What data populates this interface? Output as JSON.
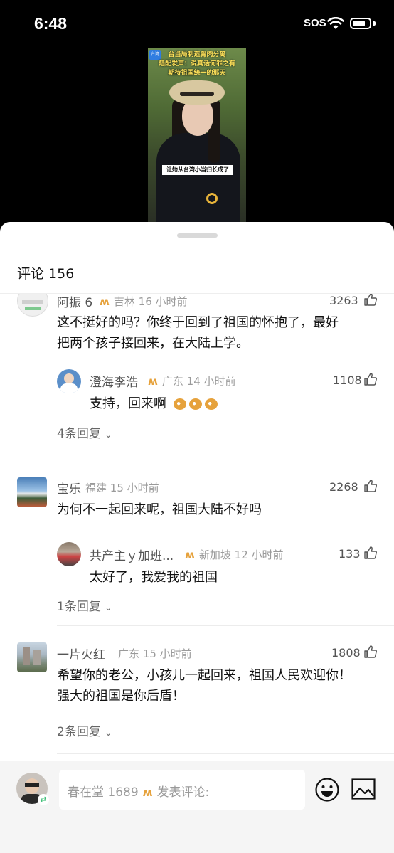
{
  "status_bar": {
    "time": "6:48",
    "sos": "SOS"
  },
  "video": {
    "caption_lines": [
      "台当局制造骨肉分离",
      "陆配发声：说真话何罪之有",
      "期待祖国统一的那天"
    ],
    "subtitle": "让她从台湾小当归长成了",
    "badge": "台湾"
  },
  "sheet": {
    "title": "评论 156"
  },
  "comments": [
    {
      "user": "阿振 6",
      "region": "吉林",
      "time": "16 小时前",
      "likes": "3263",
      "text_lines": [
        "这不挺好的吗？你终于回到了祖国的怀抱了，最好",
        "把两个孩子接回来，在大陆上学。"
      ],
      "reply": {
        "user": "澄海李浩",
        "region": "广东",
        "time": "14 小时前",
        "likes": "1108",
        "text": "支持，回来啊"
      },
      "more": "4条回复"
    },
    {
      "user": "宝乐",
      "region": "福建",
      "time": "15 小时前",
      "likes": "2268",
      "text_lines": [
        "为何不一起回来呢，祖国大陆不好吗"
      ],
      "reply": {
        "user": "共产主ｙ加班...",
        "region": "新加坡",
        "time": "12 小时前",
        "likes": "133",
        "text": "太好了，我爱我的祖国"
      },
      "more": "1条回复"
    },
    {
      "user": "一片火红",
      "region": "广东",
      "time": "15 小时前",
      "likes": "1808",
      "text_lines": [
        "希望你的老公，小孩儿一起回来，祖国人民欢迎你！",
        "强大的祖国是你后盾！"
      ],
      "more": "2条回复"
    }
  ],
  "vip_mark": "ʍ",
  "bottom_bar": {
    "username": "春在堂 1689",
    "placeholder": "发表评论:"
  },
  "colors": {
    "vip": "#e6a23c",
    "accent_green": "#19b35c"
  }
}
